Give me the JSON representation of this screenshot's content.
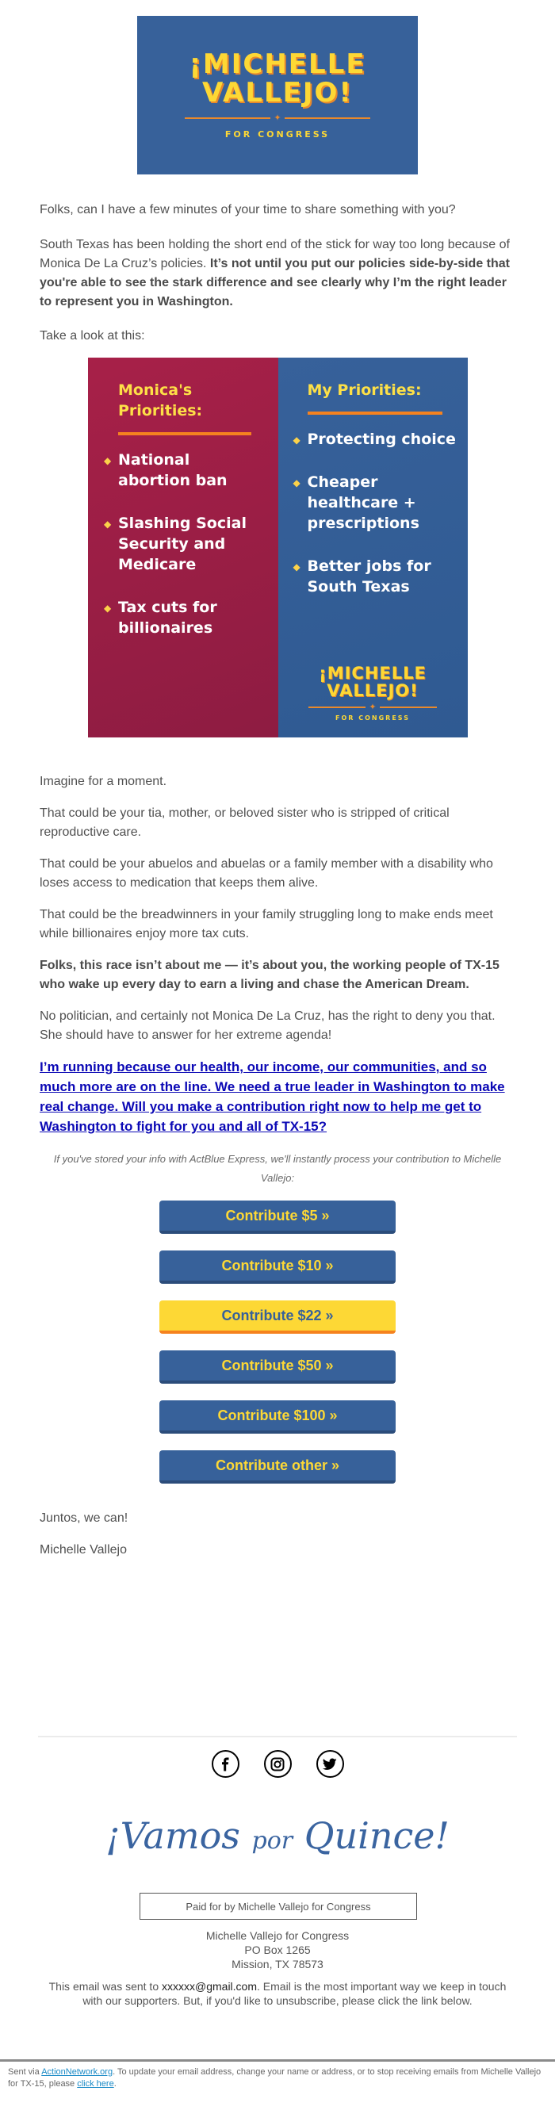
{
  "header_logo": {
    "name_line1": "¡MICHELLE",
    "name_line2": "VALLEJO!",
    "star": "✦",
    "subtitle": "FOR CONGRESS",
    "bg_color": "#37619a",
    "text_color": "#fdd835"
  },
  "body": {
    "p1": "Folks, can I have a few minutes of your time to share something with you?",
    "p2_plain": "South Texas has been holding the short end of the stick for way too long because of Monica De La Cruz’s policies. ",
    "p2_bold": "It’s not until you put our policies side-by-side that you're able to see the stark difference and see clearly why I’m the right leader to represent you in Washington.",
    "p3": "Take a look at this:",
    "p4": "Imagine for a moment.",
    "p5": "That could be your tia, mother, or beloved sister who is stripped of critical reproductive care.",
    "p6": "That could be your abuelos and abuelas or a family member with a disability who loses access to medication that keeps them alive.",
    "p7": "That could be the breadwinners in your family struggling long to make ends meet while billionaires enjoy more tax cuts.",
    "p8_bold": "Folks, this race isn’t about me — it’s about you, the working people of TX-15 who wake up every day to earn a living and chase the American Dream.",
    "p9": "No politician, and certainly not Monica De La Cruz, has the right to deny you that. She should have to answer for her extreme agenda!",
    "p10_link": "I’m running because our health, our income, our communities, and so much more are on the line. We need a true leader in Washington to make real change. Will you make a contribution right now to help me get to Washington to fight for you and all of TX-15?",
    "actblue_note": "If you've stored your info with ActBlue Express, we'll instantly process your contribution to Michelle Vallejo:",
    "closing": "Juntos, we can!",
    "signature": "Michelle Vallejo"
  },
  "comparison": {
    "left": {
      "title": "Monica's Priorities:",
      "items": [
        "National abortion ban",
        "Slashing Social Security and Medicare",
        "Tax cuts for billionaires"
      ],
      "color": "#a72048"
    },
    "right": {
      "title": "My Priorities:",
      "items": [
        "Protecting choice",
        "Cheaper healthcare + prescriptions",
        "Better jobs for South Texas"
      ],
      "color": "#37619a"
    },
    "bullet": "◆",
    "mini_logo": {
      "name_line1": "¡MICHELLE",
      "name_line2": "VALLEJO!",
      "star": "✦",
      "subtitle": "FOR CONGRESS"
    }
  },
  "buttons": [
    {
      "label": "Contribute $5 »",
      "featured": false
    },
    {
      "label": "Contribute $10 »",
      "featured": false
    },
    {
      "label": "Contribute $22 »",
      "featured": true
    },
    {
      "label": "Contribute $50 »",
      "featured": false
    },
    {
      "label": "Contribute $100 »",
      "featured": false
    },
    {
      "label": "Contribute other »",
      "featured": false
    }
  ],
  "socials": [
    {
      "name": "facebook-icon"
    },
    {
      "name": "instagram-icon"
    },
    {
      "name": "twitter-icon"
    }
  ],
  "slogan": {
    "part1": "¡Vamos",
    "part2": "por",
    "part3": "Quince!"
  },
  "footer": {
    "paid_for": "Paid for by Michelle Vallejo for Congress",
    "address_line1": "Michelle Vallejo for Congress",
    "address_line2": "PO Box 1265",
    "address_line3": "Mission, TX 78573",
    "sent_to_prefix": "This email was sent to ",
    "email": "xxxxxx@gmail.com",
    "sent_to_suffix": ". Email is the most important way we keep in touch with our supporters. But, if you'd like to unsubscribe, please click the link below.",
    "sent_via_prefix": "Sent via ",
    "sent_via_link": "ActionNetwork.org",
    "sent_via_middle": ". To update your email address, change your name or address, or to stop receiving emails from Michelle Vallejo for TX-15, please ",
    "click_here": "click here",
    "sent_via_end": "."
  }
}
